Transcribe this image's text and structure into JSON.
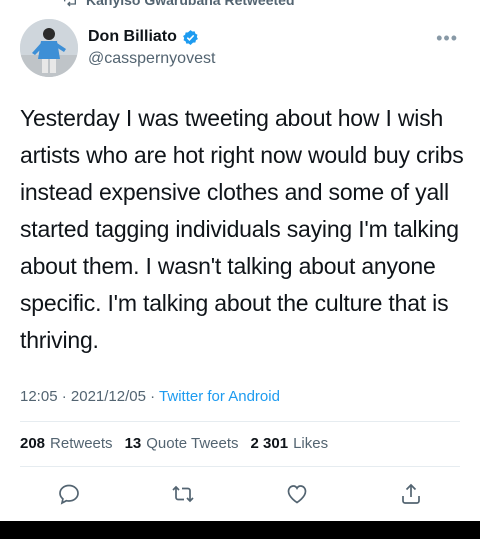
{
  "retweet_header": "Kanyiso Gwarubana Retweeted",
  "author": {
    "name": "Don Billiato",
    "handle": "@casspernyovest",
    "verified": true
  },
  "tweet": {
    "text": "Yesterday I was tweeting about how I wish artists who are hot right now would buy cribs instead expensive clothes and some of yall started tagging individuals saying I'm talking about them. I wasn't talking about anyone specific. I'm talking about the culture that is thriving.",
    "time": "12:05",
    "date": "2021/12/05",
    "source": "Twitter for Android"
  },
  "stats": {
    "retweets_count": "208",
    "retweets_label": "Retweets",
    "quotes_count": "13",
    "quotes_label": "Quote Tweets",
    "likes_count": "2 301",
    "likes_label": "Likes"
  },
  "colors": {
    "accent": "#1d9bf0",
    "text": "#0f1419",
    "muted": "#536471"
  },
  "icons": {
    "reply": "reply-icon",
    "retweet": "retweet-icon",
    "like": "heart-icon",
    "share": "share-icon"
  }
}
